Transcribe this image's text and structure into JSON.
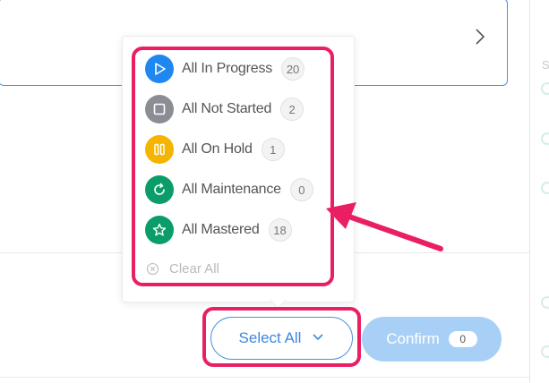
{
  "filters": {
    "items": [
      {
        "label": "All In Progress",
        "count": "20",
        "icon": "play-icon",
        "color": "#1e88f0"
      },
      {
        "label": "All Not Started",
        "count": "2",
        "icon": "square-icon",
        "color": "#8a8d93"
      },
      {
        "label": "All On Hold",
        "count": "1",
        "icon": "pause-icon",
        "color": "#f5b400"
      },
      {
        "label": "All Maintenance",
        "count": "0",
        "icon": "refresh-icon",
        "color": "#0a9d6a"
      },
      {
        "label": "All Mastered",
        "count": "18",
        "icon": "star-icon",
        "color": "#0a9d6a"
      }
    ],
    "clear_all_label": "Clear All"
  },
  "buttons": {
    "select_all_label": "Select All",
    "confirm_label": "Confirm",
    "confirm_count": "0"
  },
  "colors": {
    "highlight": "#ea1f63",
    "primary_blue": "#4a90e2",
    "confirm_disabled": "#a8d0f6"
  }
}
